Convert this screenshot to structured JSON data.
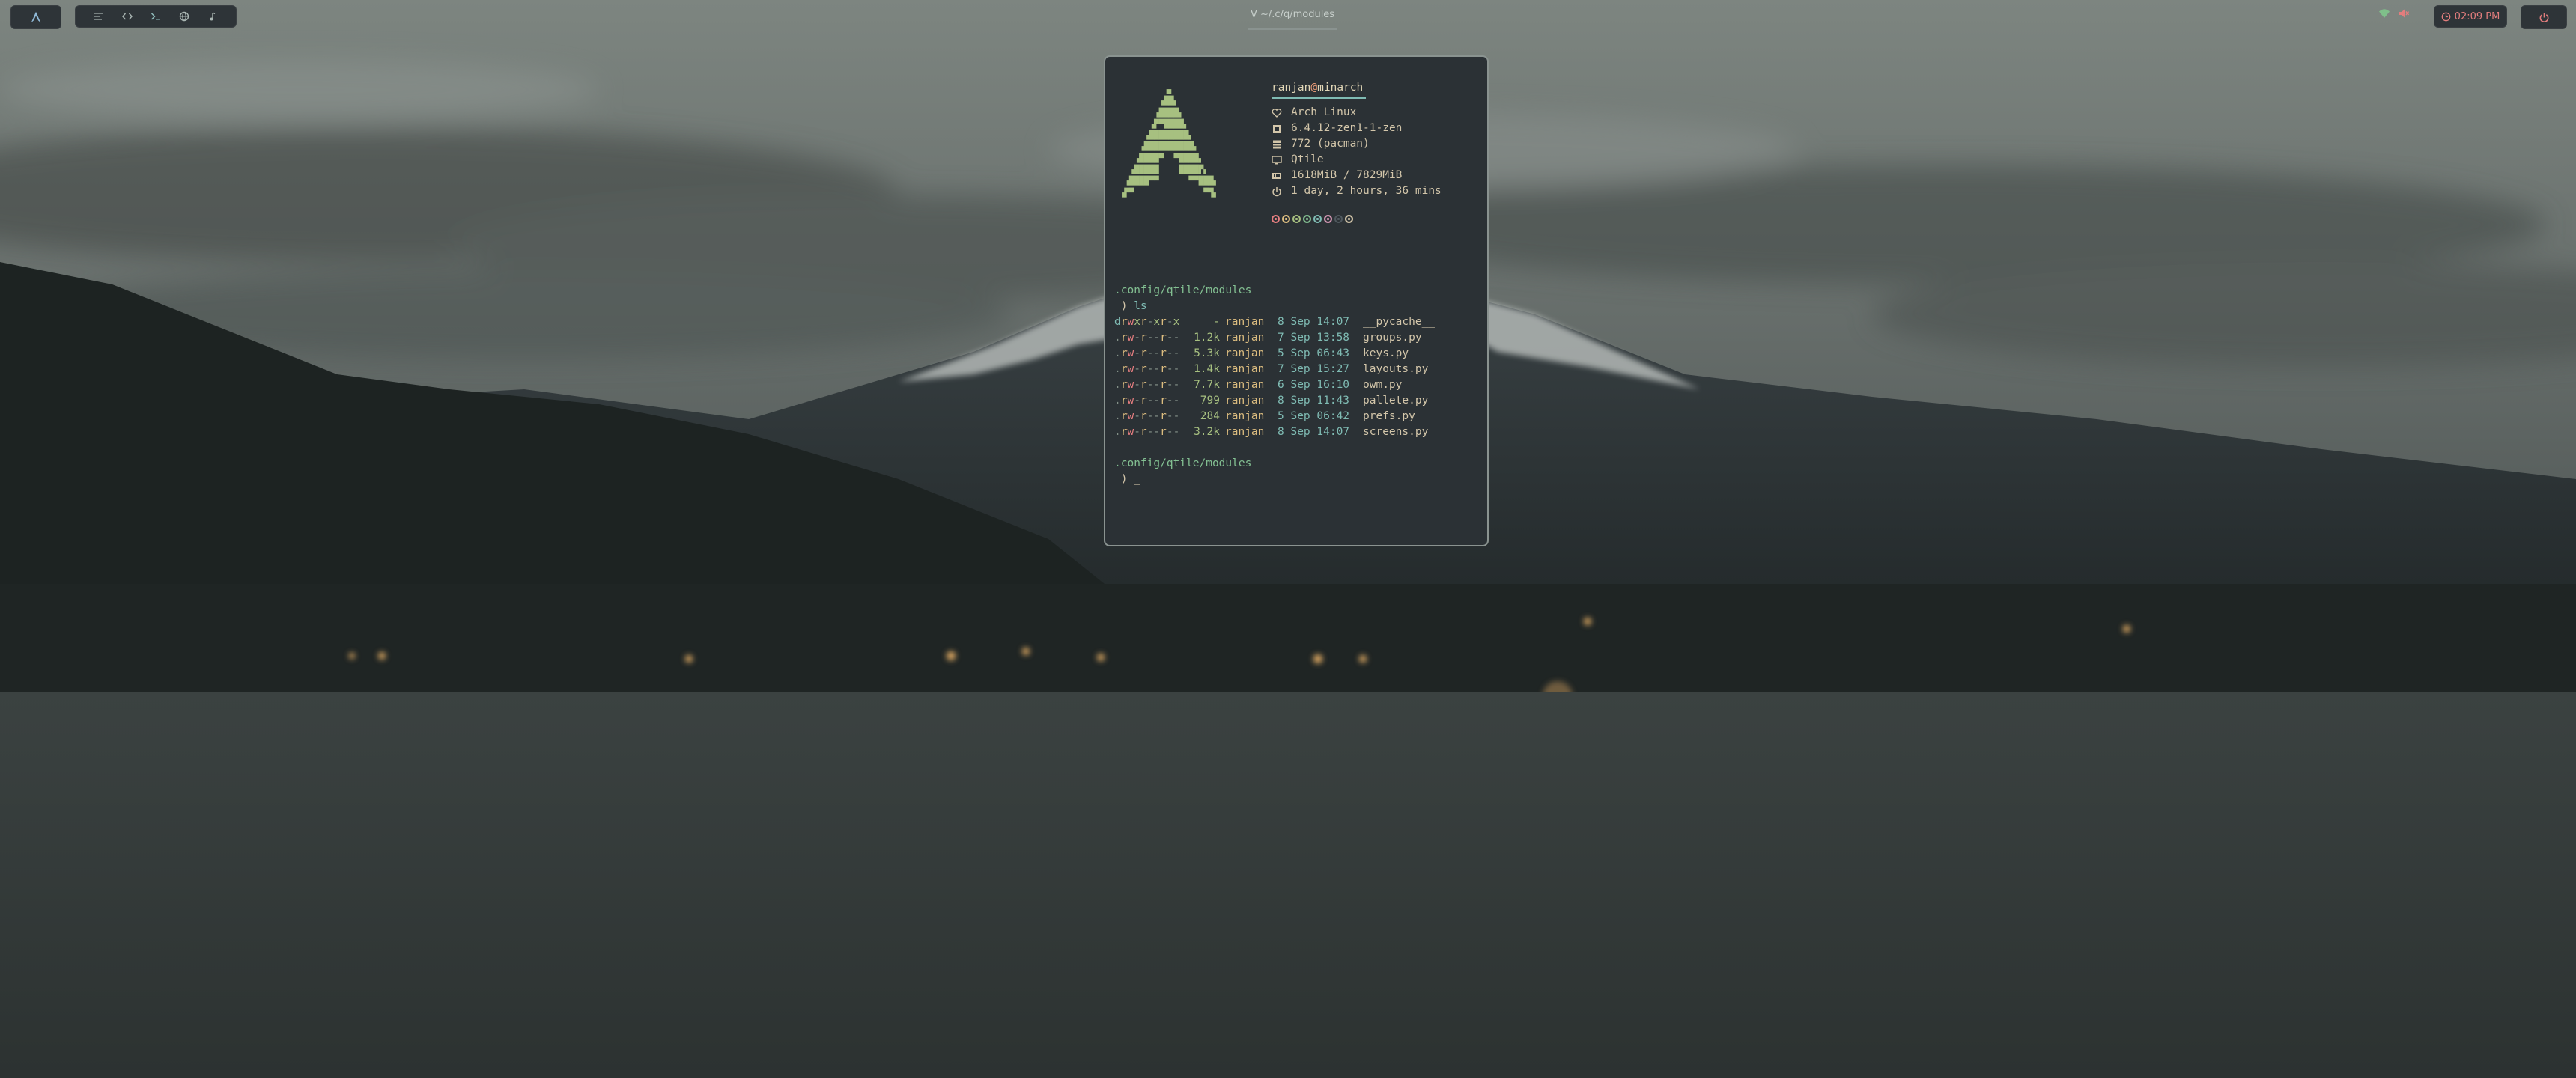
{
  "bar": {
    "launcher_icon": "arch-logo-icon",
    "groups": [
      {
        "icon": "text-lines-icon",
        "active": false
      },
      {
        "icon": "code-icon",
        "active": false
      },
      {
        "icon": "terminal-icon",
        "active": true
      },
      {
        "icon": "browser-globe-icon",
        "active": false
      },
      {
        "icon": "music-note-icon",
        "active": false
      }
    ],
    "window_title": "V ~/.c/q/modules",
    "tray": {
      "wifi_icon": "wifi-icon",
      "volume_icon": "volume-muted-icon"
    },
    "clock": {
      "icon": "clock-icon",
      "time": "02:09 PM"
    },
    "power_icon": "power-icon"
  },
  "terminal": {
    "fetch": {
      "user": "ranjan",
      "at": "@",
      "host": "minarch",
      "info": [
        {
          "icon": "heart-icon",
          "value": "Arch Linux"
        },
        {
          "icon": "chip-icon",
          "value": "6.4.12-zen1-1-zen"
        },
        {
          "icon": "package-icon",
          "value": "772 (pacman)"
        },
        {
          "icon": "monitor-icon",
          "value": "Qtile"
        },
        {
          "icon": "memory-icon",
          "value": "1618MiB / 7829MiB"
        },
        {
          "icon": "uptime-icon",
          "value": "1 day, 2 hours, 36 mins"
        }
      ],
      "palette": [
        "#e67e80",
        "#dbbc7f",
        "#a7c080",
        "#83c092",
        "#7fbbb3",
        "#d699b6",
        "#4f585e",
        "#d3c6aa"
      ]
    },
    "session": {
      "path1": ".config/qtile/modules",
      "prompt_symbol": ")",
      "command": "ls",
      "listing": [
        {
          "perm": "drwxr-xr-x",
          "size": "-",
          "owner": "ranjan",
          "date": "8 Sep 14:07",
          "name": "__pycache__"
        },
        {
          "perm": ".rw-r--r--",
          "size": "1.2k",
          "owner": "ranjan",
          "date": "7 Sep 13:58",
          "name": "groups.py"
        },
        {
          "perm": ".rw-r--r--",
          "size": "5.3k",
          "owner": "ranjan",
          "date": "5 Sep 06:43",
          "name": "keys.py"
        },
        {
          "perm": ".rw-r--r--",
          "size": "1.4k",
          "owner": "ranjan",
          "date": "7 Sep 15:27",
          "name": "layouts.py"
        },
        {
          "perm": ".rw-r--r--",
          "size": "7.7k",
          "owner": "ranjan",
          "date": "6 Sep 16:10",
          "name": "owm.py"
        },
        {
          "perm": ".rw-r--r--",
          "size": "799",
          "owner": "ranjan",
          "date": "8 Sep 11:43",
          "name": "pallete.py"
        },
        {
          "perm": ".rw-r--r--",
          "size": "284",
          "owner": "ranjan",
          "date": "5 Sep 06:42",
          "name": "prefs.py"
        },
        {
          "perm": ".rw-r--r--",
          "size": "3.2k",
          "owner": "ranjan",
          "date": "8 Sep 14:07",
          "name": "screens.py"
        }
      ],
      "path2": ".config/qtile/modules",
      "cursor": "_"
    }
  }
}
